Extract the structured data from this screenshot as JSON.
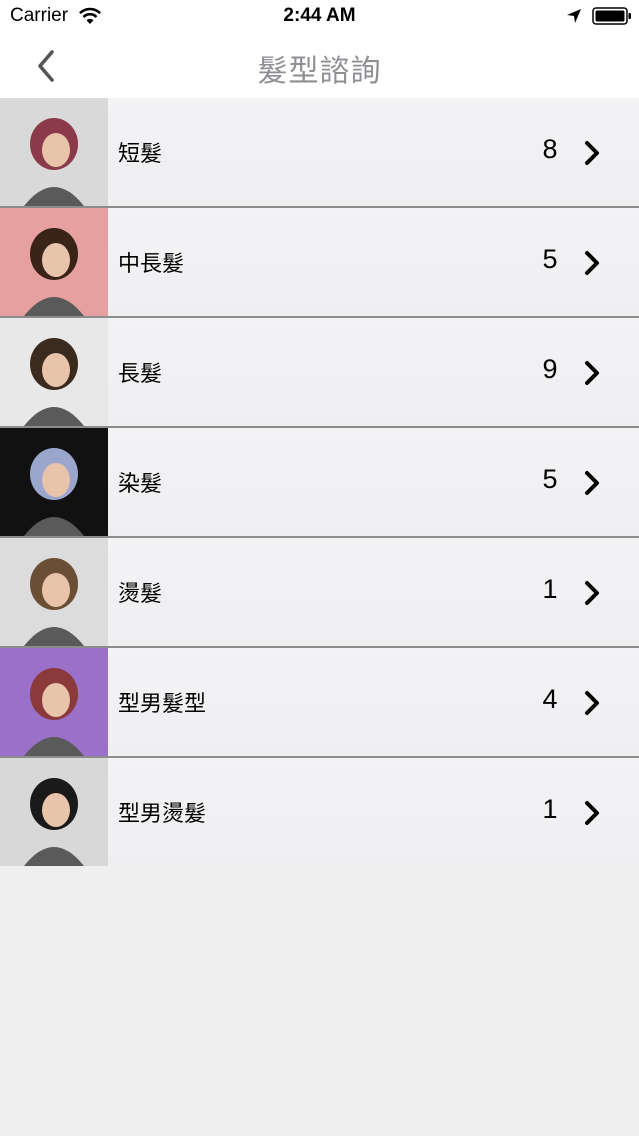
{
  "status_bar": {
    "carrier": "Carrier",
    "time": "2:44 AM"
  },
  "nav": {
    "title": "髮型諮詢",
    "back_icon": "chevron-left-icon"
  },
  "categories": [
    {
      "label": "短髮",
      "count": "8",
      "thumb_bg": "#d9d9d9",
      "hair": "#8a3a4a"
    },
    {
      "label": "中長髮",
      "count": "5",
      "thumb_bg": "#e7a0a0",
      "hair": "#3a2418"
    },
    {
      "label": "長髮",
      "count": "9",
      "thumb_bg": "#e8e8e8",
      "hair": "#3b2a1e"
    },
    {
      "label": "染髮",
      "count": "5",
      "thumb_bg": "#111111",
      "hair": "#9aa6cc"
    },
    {
      "label": "燙髮",
      "count": "1",
      "thumb_bg": "#dcdcdc",
      "hair": "#6b4f35"
    },
    {
      "label": "型男髮型",
      "count": "4",
      "thumb_bg": "#9a70c8",
      "hair": "#8a3a3a"
    },
    {
      "label": "型男燙髮",
      "count": "1",
      "thumb_bg": "#d8d8d8",
      "hair": "#1a1a1a"
    }
  ]
}
